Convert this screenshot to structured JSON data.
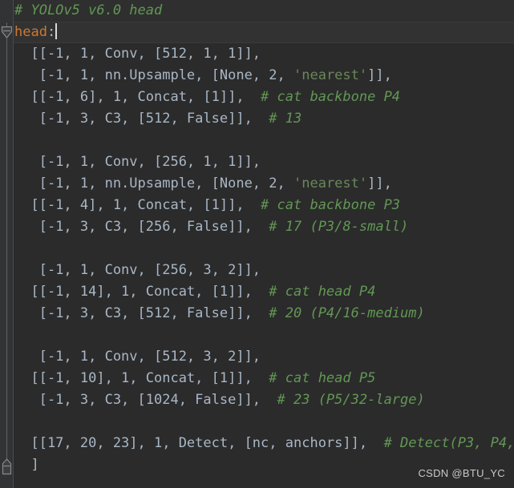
{
  "editor": {
    "theme_name": "darcula",
    "background": "#2b2b2b",
    "gutter_background": "#313335",
    "code_color": "#a9b7c6",
    "comment_color": "#629755",
    "keyword_color": "#cc7832",
    "string_color": "#6a8759",
    "caret_color": "#d8d8d8"
  },
  "fold": {
    "expanded_marker_name": "fold-expanded-triangle",
    "end_marker_name": "fold-region-end"
  },
  "lines": [
    {
      "kind": "comment",
      "text": "# YOLOv5 v6.0 head"
    },
    {
      "kind": "key",
      "key": "head",
      "colon": ":",
      "caret": true
    },
    {
      "kind": "code",
      "code": "  [[-1, 1, Conv, [512, 1, 1]],"
    },
    {
      "kind": "string",
      "pre": "   [-1, 1, nn.Upsample, [None, 2, ",
      "str": "'nearest'",
      "post": "]],"
    },
    {
      "kind": "code",
      "code": "  [[-1, 6], 1, Concat, [1]],",
      "comment": "  # cat backbone P4"
    },
    {
      "kind": "code",
      "code": "   [-1, 3, C3, [512, False]],",
      "comment": "  # 13"
    },
    {
      "kind": "blank",
      "code": ""
    },
    {
      "kind": "code",
      "code": "   [-1, 1, Conv, [256, 1, 1]],"
    },
    {
      "kind": "string",
      "pre": "   [-1, 1, nn.Upsample, [None, 2, ",
      "str": "'nearest'",
      "post": "]],"
    },
    {
      "kind": "code",
      "code": "  [[-1, 4], 1, Concat, [1]],",
      "comment": "  # cat backbone P3"
    },
    {
      "kind": "code",
      "code": "   [-1, 3, C3, [256, False]],",
      "comment": "  # 17 (P3/8-small)"
    },
    {
      "kind": "blank",
      "code": ""
    },
    {
      "kind": "code",
      "code": "   [-1, 1, Conv, [256, 3, 2]],"
    },
    {
      "kind": "code",
      "code": "  [[-1, 14], 1, Concat, [1]],",
      "comment": "  # cat head P4"
    },
    {
      "kind": "code",
      "code": "   [-1, 3, C3, [512, False]],",
      "comment": "  # 20 (P4/16-medium)"
    },
    {
      "kind": "blank",
      "code": ""
    },
    {
      "kind": "code",
      "code": "   [-1, 1, Conv, [512, 3, 2]],"
    },
    {
      "kind": "code",
      "code": "  [[-1, 10], 1, Concat, [1]],",
      "comment": "  # cat head P5"
    },
    {
      "kind": "code",
      "code": "   [-1, 3, C3, [1024, False]],",
      "comment": "  # 23 (P5/32-large)"
    },
    {
      "kind": "blank",
      "code": ""
    },
    {
      "kind": "code",
      "code": "  [[17, 20, 23], 1, Detect, [nc, anchors]],",
      "comment": "  # Detect(P3, P4,"
    },
    {
      "kind": "code",
      "code": "  ]"
    }
  ],
  "watermark": {
    "text": "CSDN @BTU_YC"
  }
}
